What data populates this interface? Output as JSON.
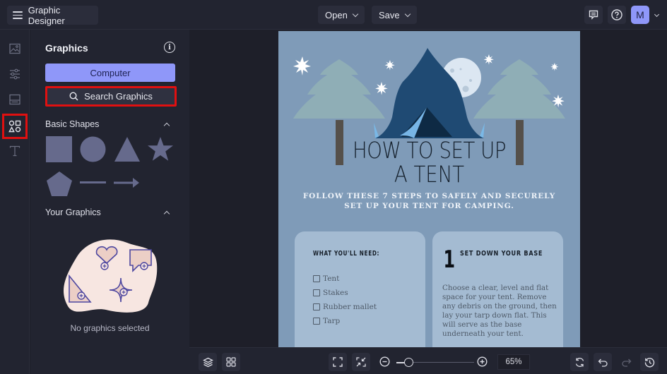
{
  "header": {
    "app_title": "Graphic Designer",
    "open_label": "Open",
    "save_label": "Save",
    "avatar_initial": "M",
    "icons": [
      "menu-icon",
      "comment-icon",
      "help-icon"
    ]
  },
  "rail": {
    "items": [
      {
        "name": "image",
        "icon": "image-icon"
      },
      {
        "name": "adjust",
        "icon": "sliders-icon"
      },
      {
        "name": "layout",
        "icon": "layout-icon"
      },
      {
        "name": "graphics",
        "icon": "shapes-icon",
        "active": true
      },
      {
        "name": "text",
        "icon": "text-icon"
      }
    ]
  },
  "panel": {
    "title": "Graphics",
    "computer_label": "Computer",
    "search_label": "Search Graphics",
    "basic_shapes_label": "Basic Shapes",
    "basic_shapes": [
      "square",
      "circle",
      "triangle",
      "star",
      "pentagon",
      "line",
      "arrow"
    ],
    "your_graphics_label": "Your Graphics",
    "empty_text": "No graphics selected"
  },
  "document": {
    "title_line1": "HOW TO SET UP",
    "title_line2": "A TENT",
    "subtitle_line1": "FOLLOW THESE 7 STEPS TO SAFELY AND SECURELY",
    "subtitle_line2": "SET UP YOUR TENT FOR CAMPING.",
    "needs": {
      "heading": "WHAT YOU'LL NEED:",
      "items": [
        "Tent",
        "Stakes",
        "Rubber mallet",
        "Tarp"
      ]
    },
    "step": {
      "number": "1",
      "heading": "SET DOWN YOUR BASE",
      "body": "Choose a clear, level and flat space for your tent. Remove any debris on the ground, then lay your tarp down flat. This will serve as the base underneath your tent."
    }
  },
  "bottombar": {
    "zoom_value": "65%",
    "zoom_level": 0.15
  },
  "colors": {
    "accent": "#8f97f9",
    "highlight": "#e01010",
    "doc_background": "#7f9bb8",
    "card_background": "#a4bbd2"
  }
}
